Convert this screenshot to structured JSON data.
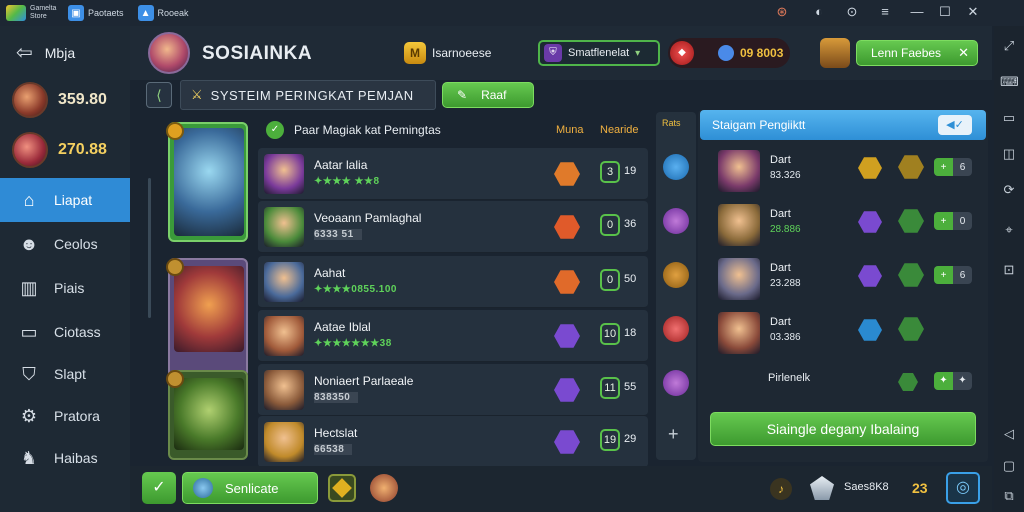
{
  "topbar": {
    "app1": "Gamelta Store",
    "app2": "Paotaets",
    "app3": "Rooeak",
    "controls": [
      "⊛",
      "◐",
      "⊙",
      "≡",
      "☐",
      "✕"
    ]
  },
  "leftnav": {
    "title": "Mbja",
    "stat1": "359.80",
    "stat2": "270.88",
    "items": [
      {
        "label": "Liapat",
        "icon": "home-icon"
      },
      {
        "label": "Ceolos",
        "icon": "people-icon"
      },
      {
        "label": "Piais",
        "icon": "chart-icon"
      },
      {
        "label": "Ciotass",
        "icon": "folder-icon"
      },
      {
        "label": "Slapt",
        "icon": "shield-icon"
      },
      {
        "label": "Pratora",
        "icon": "gear-icon"
      },
      {
        "label": "Haibas",
        "icon": "horse-icon"
      }
    ]
  },
  "header": {
    "title": "SOSIAINKA",
    "currency": "Isarnoeese",
    "dropdown": "Smatflenelat",
    "score": "09 8003",
    "button": "Lenn Faebes",
    "close": "✕"
  },
  "subheader": {
    "title": "SYSTEIM PERINGKAT PEMJAN",
    "button": "Raaf"
  },
  "rankpanel": {
    "heading": "Paar Magiak kat Pemingtas",
    "col1": "Muna",
    "col2": "Nearide",
    "rows": [
      {
        "name": "Aatar lalia",
        "score": "✦★★★ ★★8",
        "level": "19",
        "badge": "3",
        "hex": "#e07a2a",
        "face": "#7a3a9a"
      },
      {
        "name": "Veoaann Pamlaghal",
        "score": "6333 51",
        "level": "36",
        "badge": "0",
        "hex": "#e05a2a",
        "face": "#4a8a3a",
        "grey": true
      },
      {
        "name": "Aahat",
        "score": "✦★★★0855.100",
        "level": "50",
        "badge": "0",
        "hex": "#e06a2a",
        "face": "#4a6a9a"
      },
      {
        "name": "Aatae Iblal",
        "score": "✦★★★★★★38",
        "level": "18",
        "badge": "10",
        "hex": "#7a4ad0",
        "face": "#a05a3a"
      },
      {
        "name": "Noniaert Parlaeale",
        "score": "838350",
        "level": "55",
        "badge": "11",
        "hex": "#7a4ad0",
        "face": "#8a5a3a",
        "grey": true
      },
      {
        "name": "Hectslat",
        "score": "66538",
        "level": "29",
        "badge": "19",
        "hex": "#7a4ad0",
        "face": "#c08a2a",
        "grey": true
      }
    ]
  },
  "rightpanel": {
    "heading": "Staigam Pengiiktt",
    "rows": [
      {
        "name": "Dart",
        "score": "83.326",
        "green": false,
        "h1": "#d0a020",
        "h2": "#a08020",
        "mini": "6",
        "face": "#7a3a6a"
      },
      {
        "name": "Dart",
        "score": "28.886",
        "green": true,
        "h1": "#7a4ad0",
        "h2": "#3a8a3a",
        "mini": "0",
        "face": "#8a6a3a"
      },
      {
        "name": "Dart",
        "score": "23.288",
        "green": false,
        "h1": "#7a4ad0",
        "h2": "#3a8a3a",
        "mini": "6",
        "face": "#6a6a8a"
      },
      {
        "name": "Dart",
        "score": "03.386",
        "green": false,
        "h1": "#2a8ad0",
        "h2": "#3a8a3a",
        "mini": "",
        "face": "#8a4a3a"
      }
    ],
    "footer_label": "Pirlenelk",
    "button": "Siaingle degany Ibalaing"
  },
  "bottombar": {
    "button": "Senlicate",
    "right_label": "Saes8K8",
    "right_value": "23"
  }
}
